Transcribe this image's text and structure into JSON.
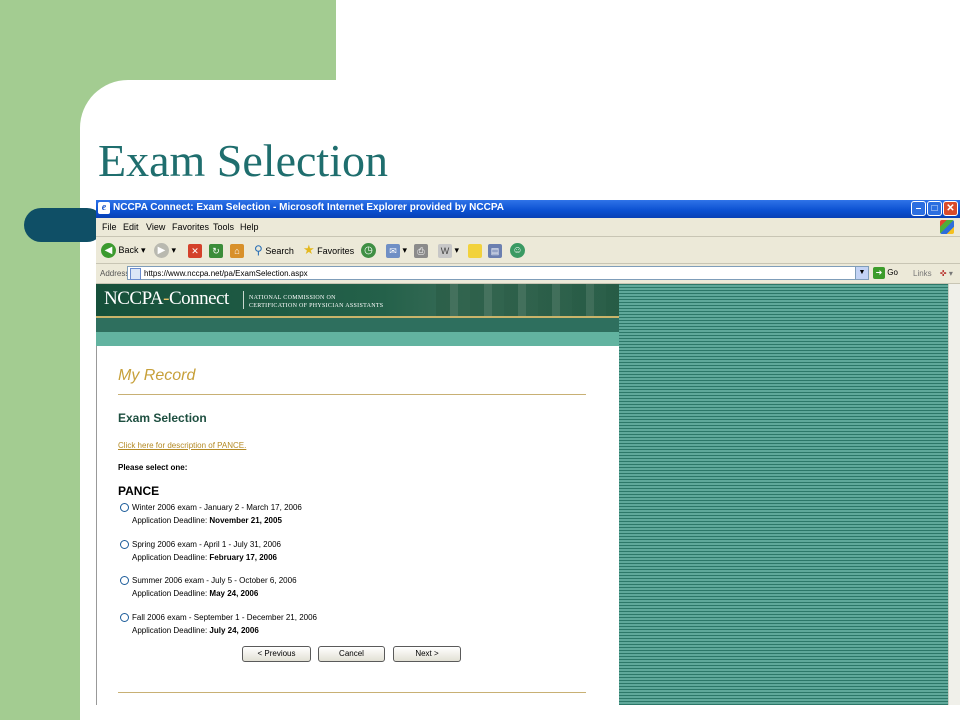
{
  "slide": {
    "title": "Exam Selection"
  },
  "window": {
    "title": "NCCPA Connect: Exam Selection - Microsoft Internet Explorer provided by NCCPA"
  },
  "menu": [
    "File",
    "Edit",
    "View",
    "Favorites",
    "Tools",
    "Help"
  ],
  "toolbar": {
    "back": "Back",
    "search": "Search",
    "favorites": "Favorites"
  },
  "address": {
    "label": "Address",
    "url": "https://www.nccpa.net/pa/ExamSelection.aspx",
    "go": "Go",
    "links": "Links"
  },
  "site": {
    "logo_left": "NCCPA",
    "logo_dash": "-",
    "logo_right": "Connect",
    "org_line1": "NATIONAL COMMISSION ON",
    "org_line2": "CERTIFICATION OF PHYSICIAN ASSISTANTS"
  },
  "page": {
    "section": "My Record",
    "heading": "Exam Selection",
    "description_link": "Click here for description of PANCE.",
    "prompt": "Please select one:",
    "exam_group": "PANCE",
    "deadline_label": "Application Deadline:",
    "options": [
      {
        "label": "Winter 2006 exam - January 2 - March 17, 2006",
        "deadline": "November 21, 2005"
      },
      {
        "label": "Spring 2006 exam - April 1 - July 31, 2006",
        "deadline": "February 17, 2006"
      },
      {
        "label": "Summer 2006 exam - July 5 - October 6, 2006",
        "deadline": "May 24, 2006"
      },
      {
        "label": "Fall 2006 exam - September 1 - December 21, 2006",
        "deadline": "July 24, 2006"
      }
    ],
    "buttons": {
      "previous": "< Previous",
      "cancel": "Cancel",
      "next": "Next >"
    }
  }
}
